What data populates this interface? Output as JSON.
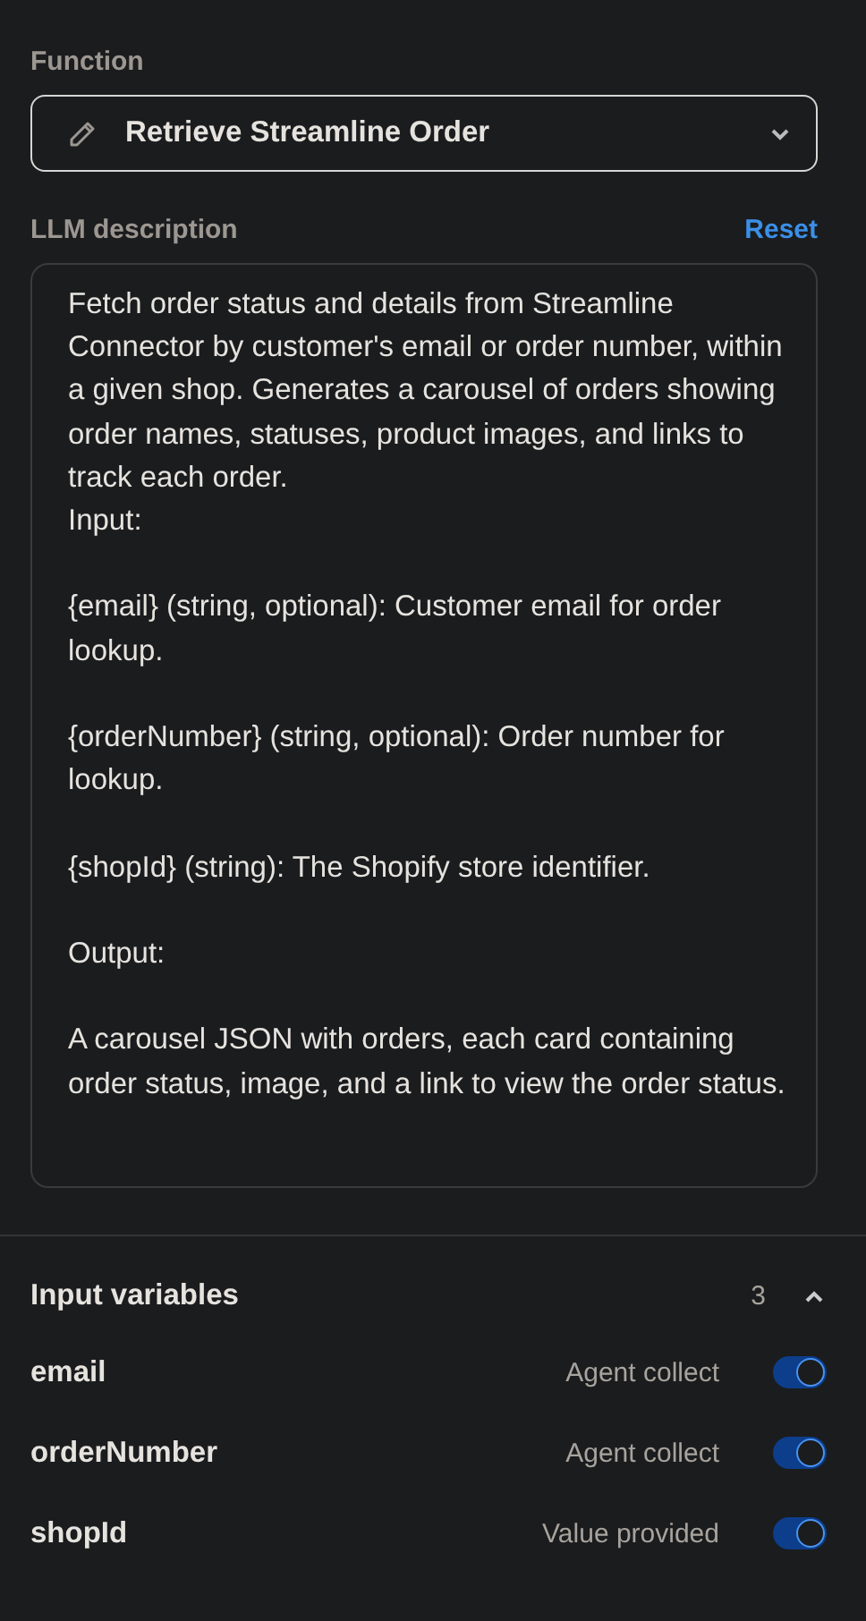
{
  "function": {
    "label": "Function",
    "value": "Retrieve Streamline Order"
  },
  "llm_description": {
    "label": "LLM description",
    "reset": "Reset",
    "value": "Fetch order status and details from Streamline Connector by customer's email or order number, within a given shop. Generates a carousel of orders showing order names, statuses, product images, and links to track each order.\nInput:\n\n{email} (string, optional): Customer email for order lookup.\n\n{orderNumber} (string, optional): Order number for lookup.\n\n{shopId} (string): The Shopify store identifier.\n\nOutput:\n\nA carousel JSON with orders, each card containing order status, image, and a link to view the order status."
  },
  "input_variables": {
    "title": "Input variables",
    "count": "3",
    "expanded": true,
    "items": [
      {
        "name": "email",
        "source": "Agent collect",
        "on": true
      },
      {
        "name": "orderNumber",
        "source": "Agent collect",
        "on": true
      },
      {
        "name": "shopId",
        "source": "Value provided",
        "on": true
      }
    ]
  }
}
